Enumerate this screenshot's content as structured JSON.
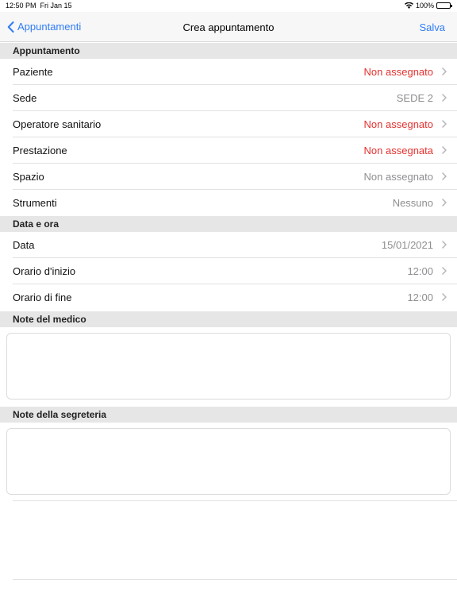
{
  "status": {
    "time": "12:50 PM",
    "date": "Fri Jan 15",
    "battery": "100%",
    "wifi_icon": "wifi-icon",
    "battery_icon": "battery-icon"
  },
  "nav": {
    "back_label": "Appuntamenti",
    "title": "Crea appuntamento",
    "save_label": "Salva"
  },
  "sections": {
    "appuntamento": {
      "header": "Appuntamento",
      "rows": [
        {
          "label": "Paziente",
          "value": "Non assegnato"
        },
        {
          "label": "Sede",
          "value": "SEDE 2"
        },
        {
          "label": "Operatore sanitario",
          "value": "Non assegnato"
        },
        {
          "label": "Prestazione",
          "value": "Non assegnata"
        },
        {
          "label": "Spazio",
          "value": "Non assegnato"
        },
        {
          "label": "Strumenti",
          "value": "Nessuno"
        }
      ]
    },
    "data_ora": {
      "header": "Data e ora",
      "rows": [
        {
          "label": "Data",
          "value": "15/01/2021"
        },
        {
          "label": "Orario d'inizio",
          "value": "12:00"
        },
        {
          "label": "Orario di fine",
          "value": "12:00"
        }
      ]
    },
    "note_medico": {
      "header": "Note del medico",
      "value": ""
    },
    "note_segreteria": {
      "header": "Note della segreteria",
      "value": ""
    }
  },
  "colors": {
    "accent": "#2f7cf6",
    "unassigned": "#e5322f",
    "secondary": "#8e8e93",
    "section_bg": "#e6e6e6"
  }
}
